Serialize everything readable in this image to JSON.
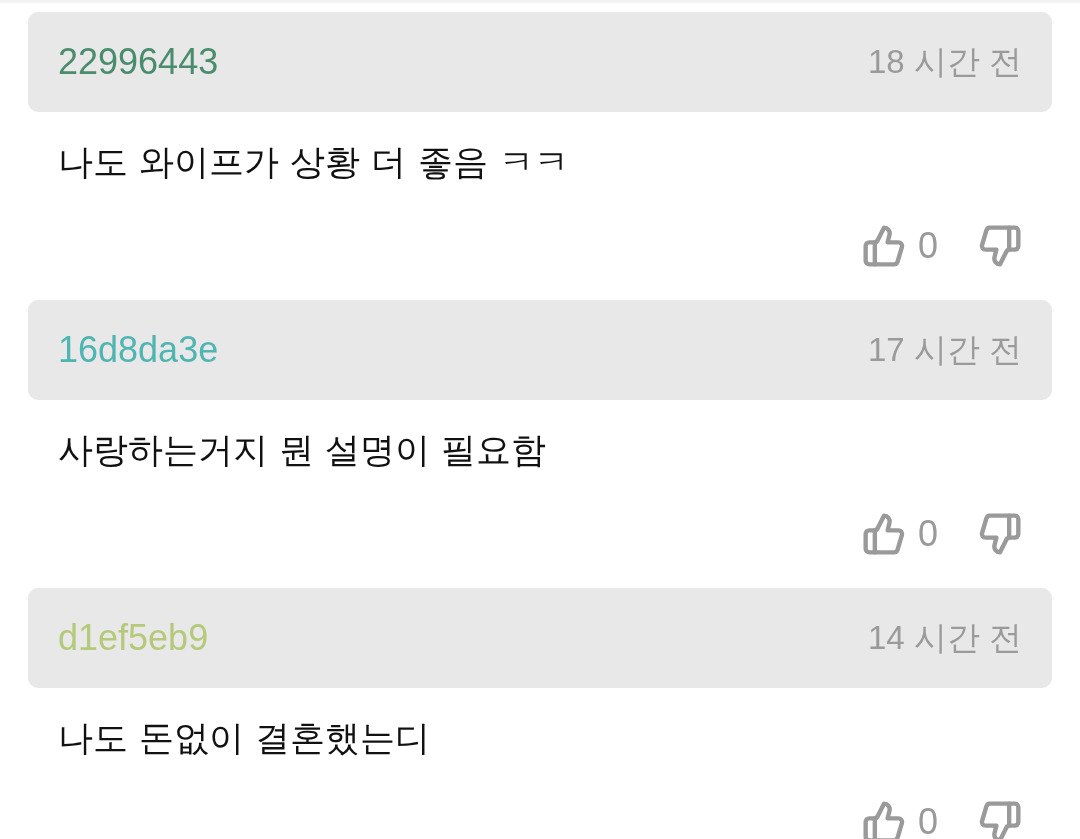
{
  "comments": [
    {
      "user": "22996443",
      "color": "#4a8c6e",
      "time": "18 시간 전",
      "text": "나도 와이프가 상황 더 좋음 ㅋㅋ",
      "likes": "0"
    },
    {
      "user": "16d8da3e",
      "color": "#4eb5b3",
      "time": "17 시간 전",
      "text": "사랑하는거지 뭔 설명이 필요함",
      "likes": "0"
    },
    {
      "user": "d1ef5eb9",
      "color": "#b5c97a",
      "time": "14 시간 전",
      "text": "나도 돈없이 결혼했는디",
      "likes": "0"
    }
  ]
}
